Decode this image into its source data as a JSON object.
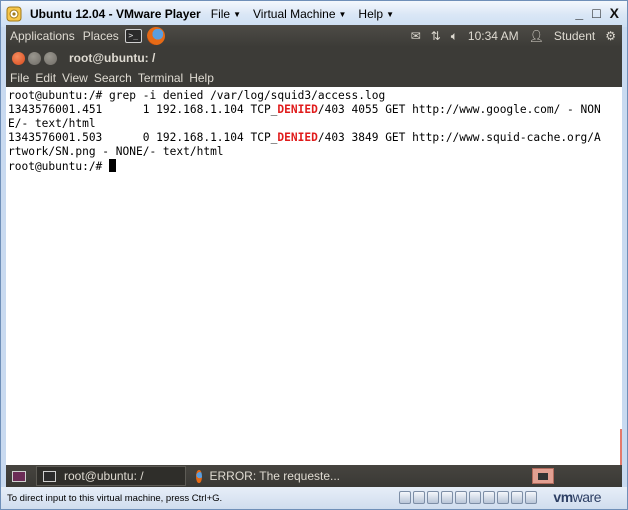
{
  "vmware": {
    "title": "Ubuntu 12.04 - VMware Player",
    "menu": [
      {
        "label": "File"
      },
      {
        "label": "Virtual Machine"
      },
      {
        "label": "Help"
      }
    ],
    "controls": {
      "minimize": "_",
      "restore": "□",
      "close": "X"
    },
    "status_hint": "To direct input to this virtual machine, press Ctrl+G.",
    "brand_vm": "vm",
    "brand_ware": "ware"
  },
  "top_panel": {
    "applications": "Applications",
    "places": "Places",
    "clock": "10:34 AM",
    "user": "Student"
  },
  "terminal": {
    "title": "root@ubuntu: /",
    "menu": [
      "File",
      "Edit",
      "View",
      "Search",
      "Terminal",
      "Help"
    ],
    "lines": {
      "l1": "root@ubuntu:/# grep -i denied /var/log/squid3/access.log",
      "l2a": "1343576001.451      1 192.168.1.104 TCP_",
      "l2b": "DENIED",
      "l2c": "/403 4055 GET http://www.google.com/ - NON",
      "l3": "E/- text/html",
      "l4a": "1343576001.503      0 192.168.1.104 TCP_",
      "l4b": "DENIED",
      "l4c": "/403 3849 GET http://www.squid-cache.org/A",
      "l5": "rtwork/SN.png - NONE/- text/html",
      "l6": "root@ubuntu:/# "
    }
  },
  "taskbar": {
    "task1": "root@ubuntu: /",
    "task2": "ERROR: The requeste..."
  },
  "colors": {
    "denied": "#e01b1b",
    "panel": "#3c3b37"
  }
}
